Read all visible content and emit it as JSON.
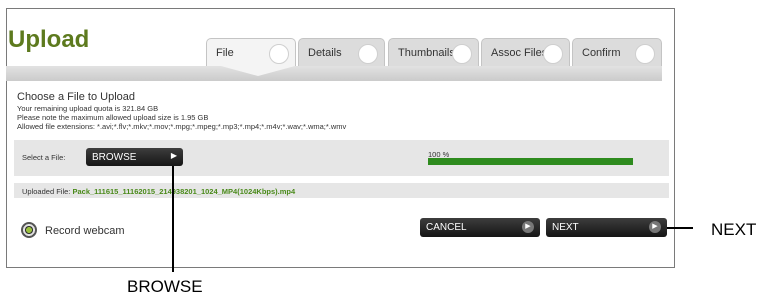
{
  "header": {
    "title": "Upload"
  },
  "tabs": [
    {
      "label": "File",
      "active": true
    },
    {
      "label": "Details"
    },
    {
      "label": "Thumbnails"
    },
    {
      "label": "Assoc Files"
    },
    {
      "label": "Confirm"
    }
  ],
  "info": {
    "heading": "Choose a File to Upload",
    "quota": "Your remaining upload quota is 321.84 GB",
    "maxsize": "Please note the maximum allowed upload size is 1.95 GB",
    "extensions": "Allowed file extensions: *.avi;*.flv;*.mkv;*.mov;*.mpg;*.mpeg;*.mp3;*.mp4;*.m4v;*.wav;*.wma;*.wmv"
  },
  "select": {
    "label": "Select a File:",
    "browse_label": "BROWSE",
    "progress_text": "100 %",
    "progress_value": 1.0
  },
  "uploaded": {
    "label": "Uploaded File:",
    "filename": "Pack_111615_11162015_214938201_1024_MP4(1024Kbps).mp4"
  },
  "footer": {
    "record_label": "Record webcam",
    "cancel_label": "CANCEL",
    "next_label": "NEXT"
  },
  "annotations": {
    "next": "NEXT",
    "browse": "BROWSE"
  },
  "colors": {
    "brand_green": "#5d7a1e",
    "progress_green": "#2e8b1e",
    "button_dark": "#151515"
  }
}
